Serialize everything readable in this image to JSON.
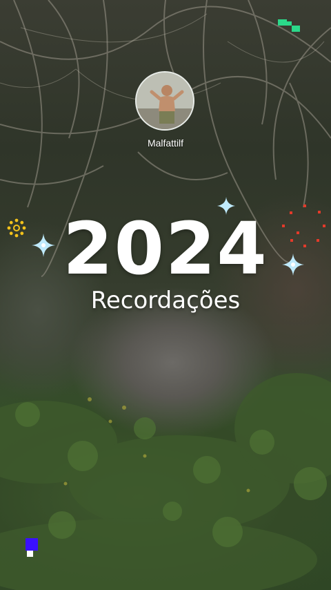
{
  "profile": {
    "username": "Malfattilf"
  },
  "recap": {
    "year": "2024",
    "subtitle": "Recordações"
  },
  "colors": {
    "sparkle": "#bfeafc",
    "confetti": "#e33a2a",
    "sun_badge": "#f3c21b",
    "pixel_green": "#2bd98a",
    "pixel_blue": "#3a10ff"
  }
}
